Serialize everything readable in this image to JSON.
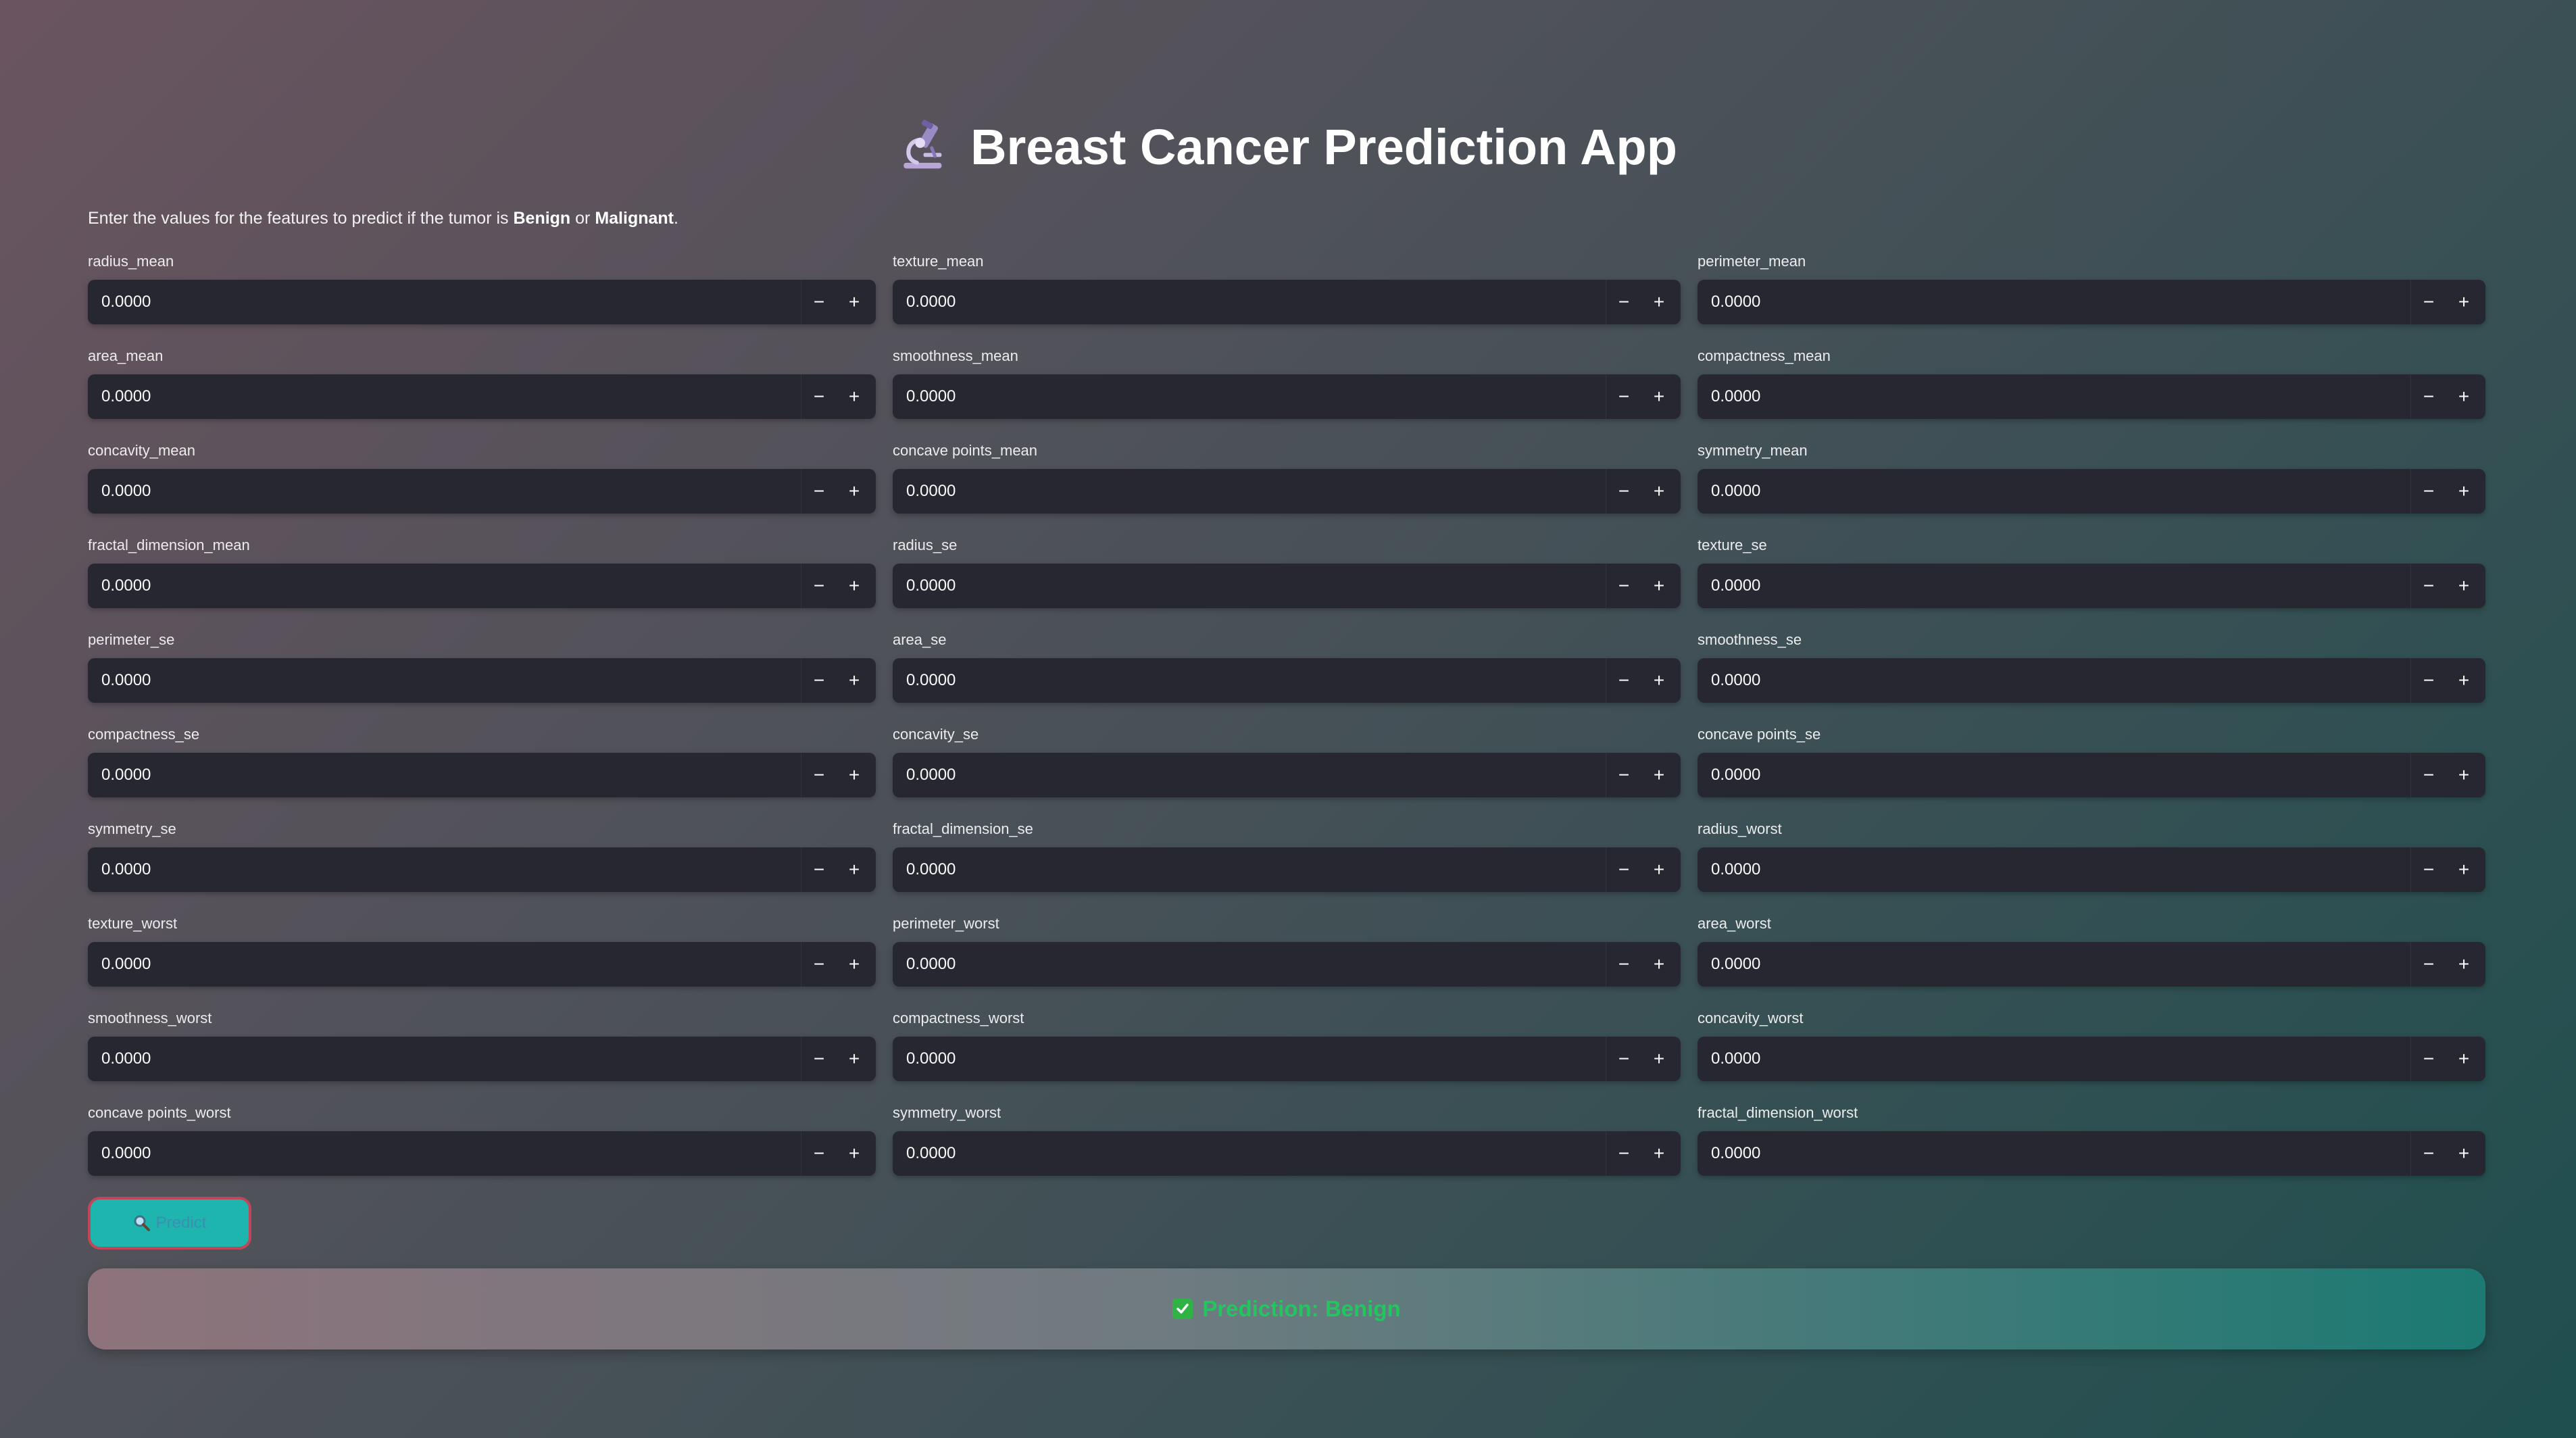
{
  "header": {
    "title": "Breast Cancer Prediction App",
    "title_icon": "microscope-icon"
  },
  "intro": {
    "prefix": "Enter the values for the features to predict if the tumor is ",
    "benign": "Benign",
    "or": " or ",
    "malignant": "Malignant",
    "suffix": "."
  },
  "fields": [
    {
      "label": "radius_mean",
      "value": "0.0000"
    },
    {
      "label": "texture_mean",
      "value": "0.0000"
    },
    {
      "label": "perimeter_mean",
      "value": "0.0000"
    },
    {
      "label": "area_mean",
      "value": "0.0000"
    },
    {
      "label": "smoothness_mean",
      "value": "0.0000"
    },
    {
      "label": "compactness_mean",
      "value": "0.0000"
    },
    {
      "label": "concavity_mean",
      "value": "0.0000"
    },
    {
      "label": "concave points_mean",
      "value": "0.0000"
    },
    {
      "label": "symmetry_mean",
      "value": "0.0000"
    },
    {
      "label": "fractal_dimension_mean",
      "value": "0.0000"
    },
    {
      "label": "radius_se",
      "value": "0.0000"
    },
    {
      "label": "texture_se",
      "value": "0.0000"
    },
    {
      "label": "perimeter_se",
      "value": "0.0000"
    },
    {
      "label": "area_se",
      "value": "0.0000"
    },
    {
      "label": "smoothness_se",
      "value": "0.0000"
    },
    {
      "label": "compactness_se",
      "value": "0.0000"
    },
    {
      "label": "concavity_se",
      "value": "0.0000"
    },
    {
      "label": "concave points_se",
      "value": "0.0000"
    },
    {
      "label": "symmetry_se",
      "value": "0.0000"
    },
    {
      "label": "fractal_dimension_se",
      "value": "0.0000"
    },
    {
      "label": "radius_worst",
      "value": "0.0000"
    },
    {
      "label": "texture_worst",
      "value": "0.0000"
    },
    {
      "label": "perimeter_worst",
      "value": "0.0000"
    },
    {
      "label": "area_worst",
      "value": "0.0000"
    },
    {
      "label": "smoothness_worst",
      "value": "0.0000"
    },
    {
      "label": "compactness_worst",
      "value": "0.0000"
    },
    {
      "label": "concavity_worst",
      "value": "0.0000"
    },
    {
      "label": "concave points_worst",
      "value": "0.0000"
    },
    {
      "label": "symmetry_worst",
      "value": "0.0000"
    },
    {
      "label": "fractal_dimension_worst",
      "value": "0.0000"
    }
  ],
  "stepper": {
    "minus": "−",
    "plus": "+"
  },
  "predict_button": {
    "label": "Predict",
    "icon": "magnifier-icon"
  },
  "result": {
    "text": "Prediction: Benign",
    "icon": "check-mark-icon"
  },
  "colors": {
    "accent": "#1db5ad",
    "button_border": "#c0475a",
    "result_text": "#22c55e",
    "input_bg": "#262730"
  }
}
